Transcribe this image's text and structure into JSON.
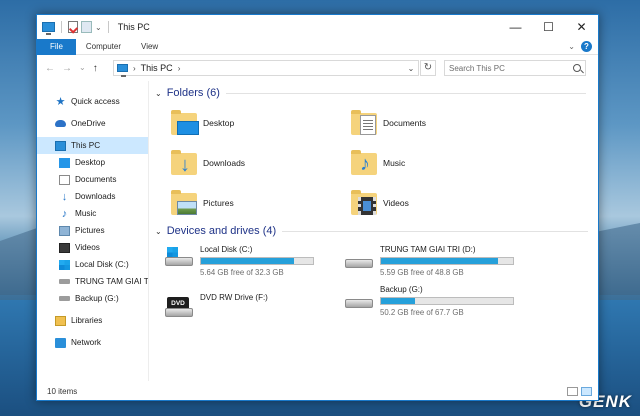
{
  "window": {
    "title": "This PC"
  },
  "caption_buttons": {
    "minimize": "—",
    "maximize": "☐",
    "close": "✕"
  },
  "ribbon": {
    "tabs": [
      "File",
      "Computer",
      "View"
    ],
    "expand": "⌄",
    "help": "?"
  },
  "navigation": {
    "back": "←",
    "forward": "→",
    "recent": "⌄",
    "up": "↑"
  },
  "address": {
    "path": "This PC",
    "separator": "›",
    "dropdown": "⌄",
    "refresh": "↻"
  },
  "search": {
    "placeholder": "Search This PC"
  },
  "sidebar": {
    "items": [
      {
        "label": "Quick access",
        "icon": "star-icon"
      },
      {
        "label": "OneDrive",
        "icon": "cloud-icon"
      },
      {
        "label": "This PC",
        "icon": "computer-icon",
        "selected": true
      },
      {
        "label": "Desktop",
        "icon": "desktop-icon"
      },
      {
        "label": "Documents",
        "icon": "document-icon"
      },
      {
        "label": "Downloads",
        "icon": "download-icon"
      },
      {
        "label": "Music",
        "icon": "music-icon"
      },
      {
        "label": "Pictures",
        "icon": "pictures-icon"
      },
      {
        "label": "Videos",
        "icon": "videos-icon"
      },
      {
        "label": "Local Disk (C:)",
        "icon": "windows-drive-icon"
      },
      {
        "label": "TRUNG TAM GIAI T",
        "icon": "drive-icon"
      },
      {
        "label": "Backup (G:)",
        "icon": "drive-icon"
      },
      {
        "label": "Libraries",
        "icon": "library-icon"
      },
      {
        "label": "Network",
        "icon": "network-icon"
      }
    ]
  },
  "folders": {
    "header": "Folders (6)",
    "items": [
      "Desktop",
      "Documents",
      "Downloads",
      "Music",
      "Pictures",
      "Videos"
    ]
  },
  "devices": {
    "header": "Devices and drives (4)",
    "items": [
      {
        "name": "Local Disk (C:)",
        "free": "5.64 GB free of 32.3 GB",
        "used_fraction": 0.83
      },
      {
        "name": "TRUNG TAM GIAI TRI  (D:)",
        "free": "5.59 GB free of 48.8 GB",
        "used_fraction": 0.89
      },
      {
        "name": "DVD RW Drive (F:)",
        "disc_label": "DVD"
      },
      {
        "name": "Backup (G:)",
        "free": "50.2 GB free of 67.7 GB",
        "used_fraction": 0.26
      }
    ]
  },
  "status": {
    "items_count": "10 items"
  },
  "watermark": "GENK",
  "colors": {
    "accent": "#1979ca",
    "selection": "#cce8ff",
    "bar_fill": "#26a0da",
    "section_heading": "#1e3287"
  }
}
